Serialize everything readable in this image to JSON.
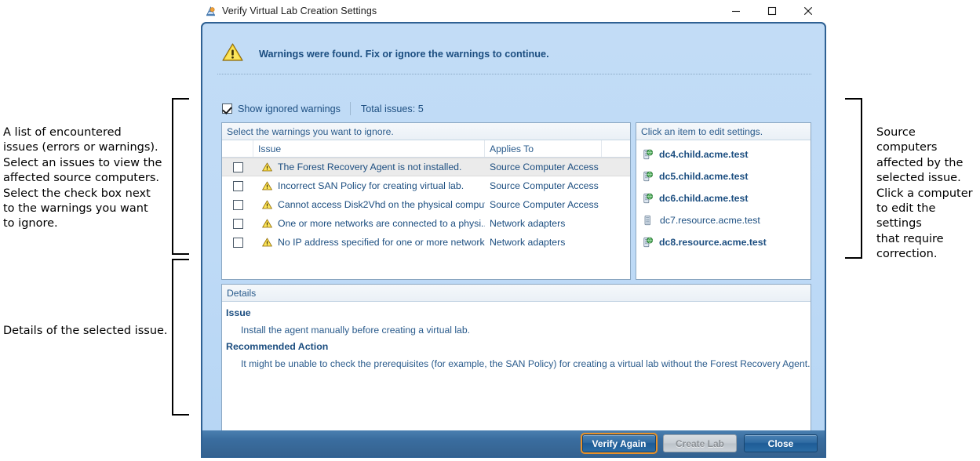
{
  "window": {
    "title": "Verify Virtual Lab Creation Settings",
    "icon": "app-icon",
    "controls": {
      "minimize": "minimize-icon",
      "maximize": "maximize-icon",
      "close": "close-icon"
    }
  },
  "banner": {
    "icon": "warning-triangle-icon",
    "text": "Warnings were found. Fix or ignore the warnings to continue."
  },
  "options": {
    "show_ignored_label": "Show ignored warnings",
    "show_ignored_checked": true,
    "total_issues": "Total issues: 5"
  },
  "issues_panel": {
    "header": "Select the warnings you want to ignore.",
    "columns": [
      "",
      "Issue",
      "Applies To",
      ""
    ],
    "rows": [
      {
        "checked": false,
        "icon": "warning-triangle-icon",
        "issue": "The Forest Recovery Agent is not installed.",
        "applies_to": "Source Computer Access",
        "selected": true
      },
      {
        "checked": false,
        "icon": "warning-triangle-icon",
        "issue": "Incorrect SAN Policy for creating virtual lab.",
        "applies_to": "Source Computer Access",
        "selected": false
      },
      {
        "checked": false,
        "icon": "warning-triangle-icon",
        "issue": "Cannot access Disk2Vhd on the physical comput...",
        "applies_to": "Source Computer Access",
        "selected": false
      },
      {
        "checked": false,
        "icon": "warning-triangle-icon",
        "issue": "One or more networks are connected to a physi...",
        "applies_to": "Network adapters",
        "selected": false
      },
      {
        "checked": false,
        "icon": "warning-triangle-icon",
        "issue": "No IP address specified for one or more networks.",
        "applies_to": "Network adapters",
        "selected": false
      }
    ]
  },
  "computers_panel": {
    "header": "Click an item to edit settings.",
    "rows": [
      {
        "icon": "server-globe-icon",
        "name": "dc4.child.acme.test",
        "style": "bold"
      },
      {
        "icon": "server-globe-icon",
        "name": "dc5.child.acme.test",
        "style": "bold"
      },
      {
        "icon": "server-globe-icon",
        "name": "dc6.child.acme.test",
        "style": "bold"
      },
      {
        "icon": "server-icon",
        "name": "dc7.resource.acme.test",
        "style": "plain"
      },
      {
        "icon": "server-globe-icon",
        "name": "dc8.resource.acme.test",
        "style": "bold"
      }
    ]
  },
  "details_panel": {
    "header": "Details",
    "issue_heading": "Issue",
    "issue_text": "Install the agent manually before creating a virtual lab.",
    "action_heading": "Recommended Action",
    "action_text": "It might be unable to check the prerequisites (for example, the SAN Policy) for creating a virtual lab without the Forest Recovery Agent."
  },
  "footer": {
    "verify_again": "Verify Again",
    "create_lab": "Create Lab",
    "close": "Close"
  },
  "annotations": {
    "left_top": "A list of encountered\nissues (errors or warnings).\nSelect an issues to view the\naffected source computers.\nSelect the check box next\nto the warnings you want\nto ignore.",
    "left_bottom": "Details of the selected issue.",
    "right": "Source computers\naffected by the\nselected issue.\nClick a computer\nto edit the settings\nthat require\ncorrection."
  },
  "colors": {
    "dialog_border": "#2f6193",
    "dialog_body": "#bedaf6",
    "footer": "#35628f",
    "accent_text": "#1c4e80",
    "warning": "#f2c01e",
    "focus_outline": "#e8922a"
  }
}
